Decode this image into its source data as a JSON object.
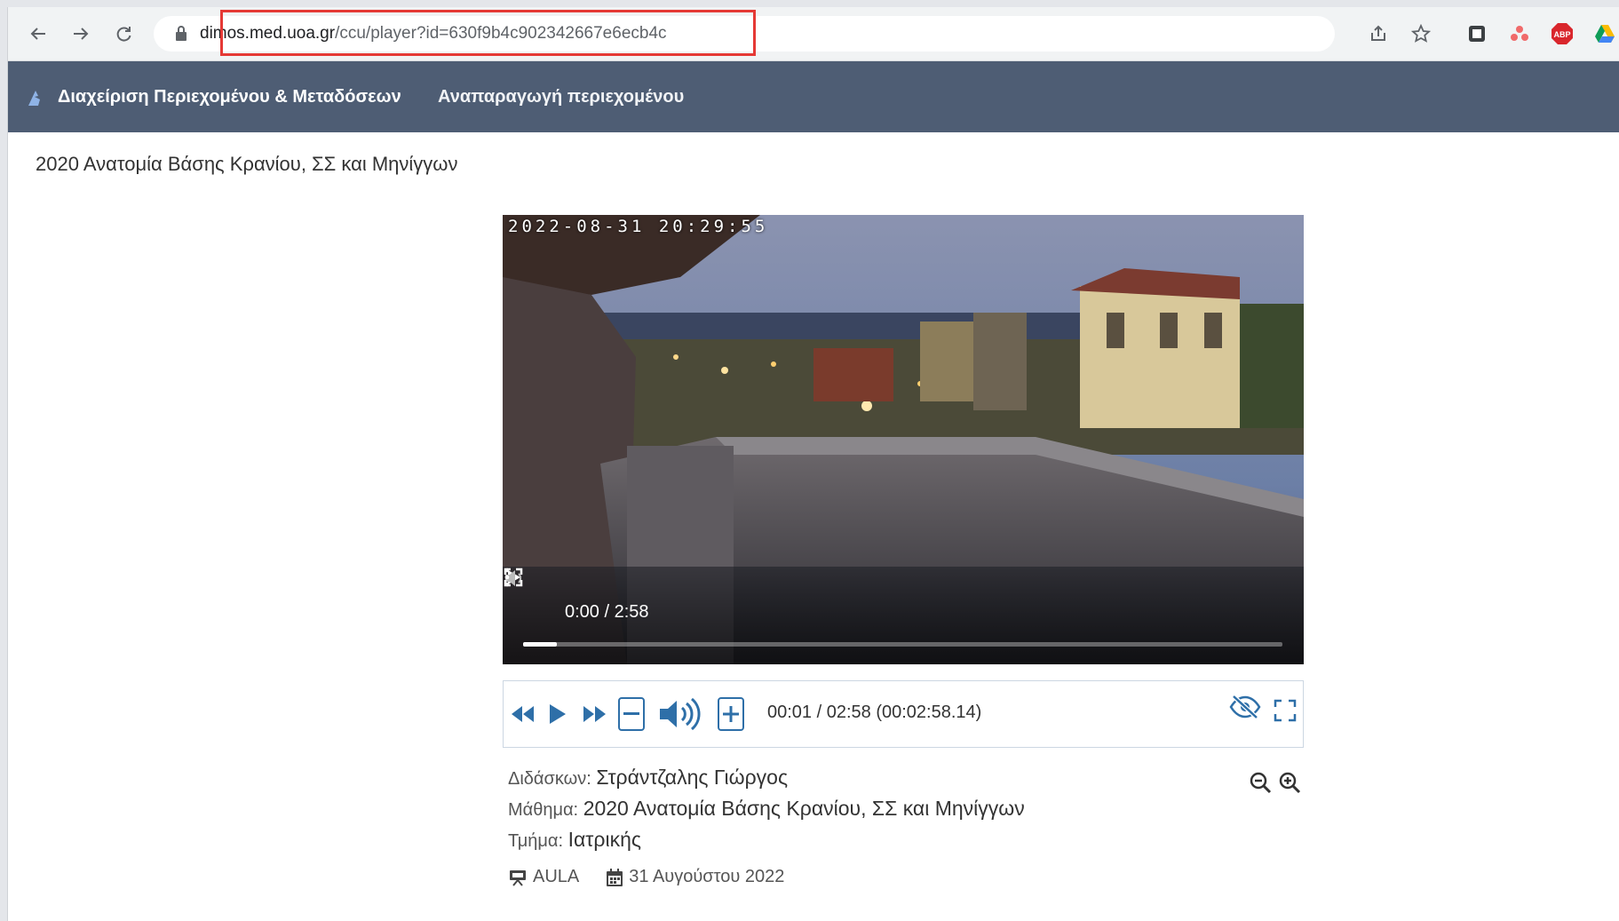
{
  "browser": {
    "url_host": "dimos.med.uoa.gr",
    "url_path": "/ccu/player?id=630f9b4c902342667e6ecb4c"
  },
  "appbar": {
    "brand": "Διαχείριση Περιεχομένου & Μεταδόσεων",
    "section": "Αναπαραγωγή περιεχομένου"
  },
  "page": {
    "title": "2020 Ανατομία Βάσης Κρανίου, ΣΣ και Μηνίγγων"
  },
  "video": {
    "timestamp": "2022-08-31 20:29:55",
    "time": "0:00 / 2:58",
    "progress_fraction": 0.045
  },
  "controls": {
    "time_display": "00:01 / 02:58 (00:02:58.14)"
  },
  "info": {
    "instructor_label": "Διδάσκων:",
    "instructor": "Στράντζαλης Γιώργος",
    "course_label": "Μάθημα:",
    "course": "2020 Ανατομία Βάσης Κρανίου, ΣΣ και Μηνίγγων",
    "department_label": "Τμήμα:",
    "department": "Ιατρικής",
    "room": "AULA",
    "date": "31 Αυγούστου 2022"
  },
  "colors": {
    "accent": "#2e6fa8",
    "appbar": "#4e5d74",
    "highlight": "#e53935"
  }
}
